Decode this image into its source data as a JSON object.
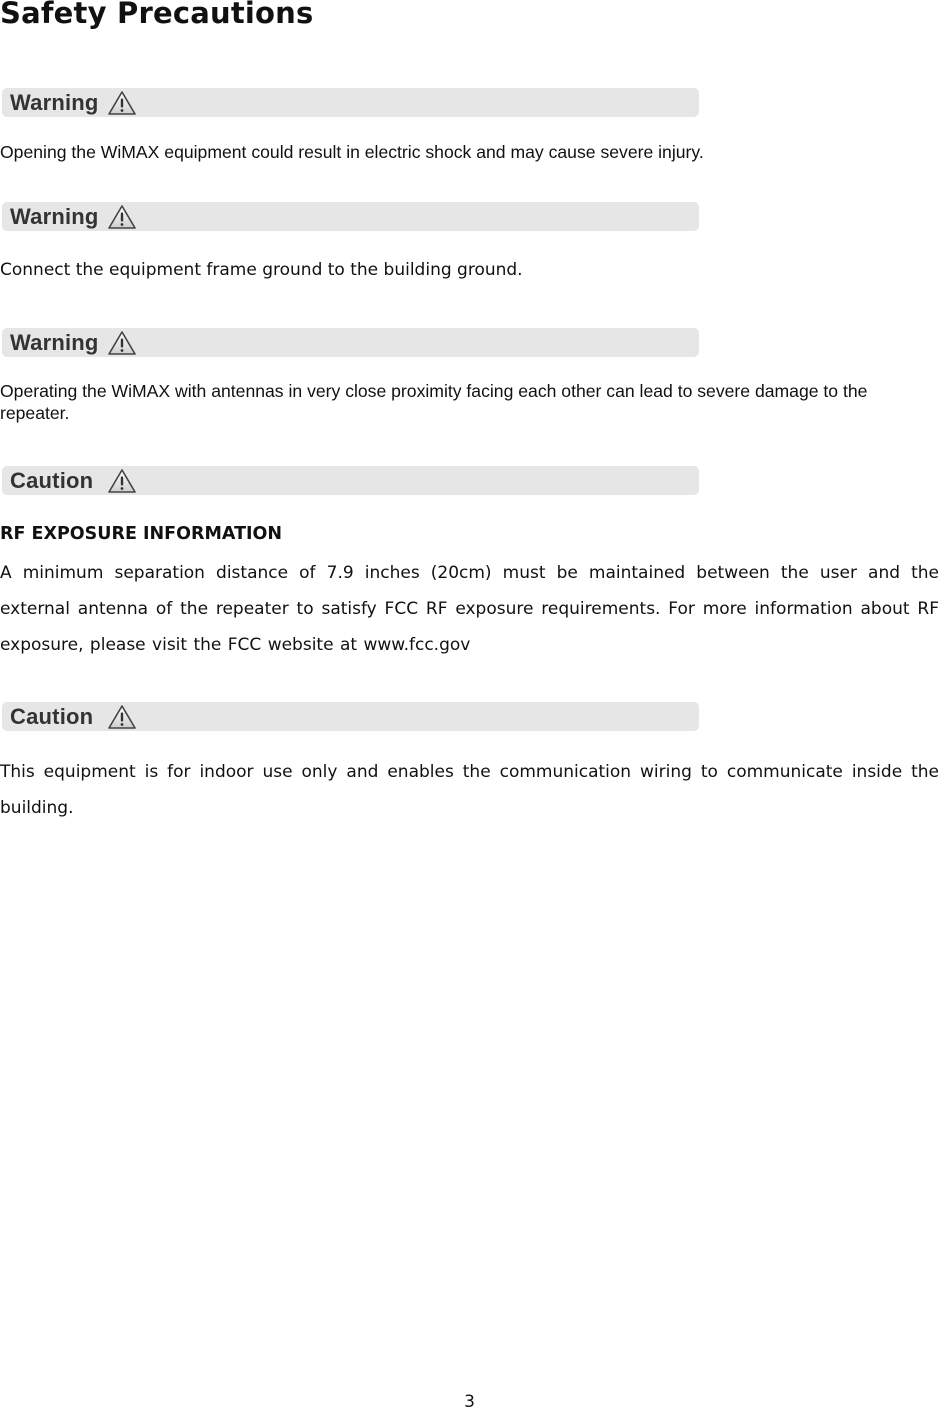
{
  "page": {
    "title": "Safety Precautions",
    "page_number": "3"
  },
  "sections": [
    {
      "label": "Warning",
      "icon": "warning-triangle-icon",
      "text": "Opening the WiMAX equipment could result in electric shock and may cause severe injury."
    },
    {
      "label": "Warning",
      "icon": "warning-triangle-icon",
      "text": "Connect the equipment frame ground to the building ground."
    },
    {
      "label": "Warning",
      "icon": "warning-triangle-icon",
      "text": "Operating the WiMAX with antennas in very close proximity facing each other can lead to severe damage to the repeater."
    },
    {
      "label": "Caution",
      "icon": "warning-triangle-icon",
      "subheading": "RF EXPOSURE INFORMATION",
      "text": "A minimum separation distance of 7.9 inches (20cm) must be maintained between the user and the external antenna of the repeater to satisfy FCC RF exposure requirements. For more information about RF exposure, please visit the FCC website at www.fcc.gov"
    },
    {
      "label": "Caution",
      "icon": "warning-triangle-icon",
      "text": "This equipment is for indoor use only and enables the communication wiring to communicate inside the building."
    }
  ],
  "colors": {
    "bar_background": "#e6e6e6",
    "bar_label": "#333333",
    "text": "#111111"
  }
}
